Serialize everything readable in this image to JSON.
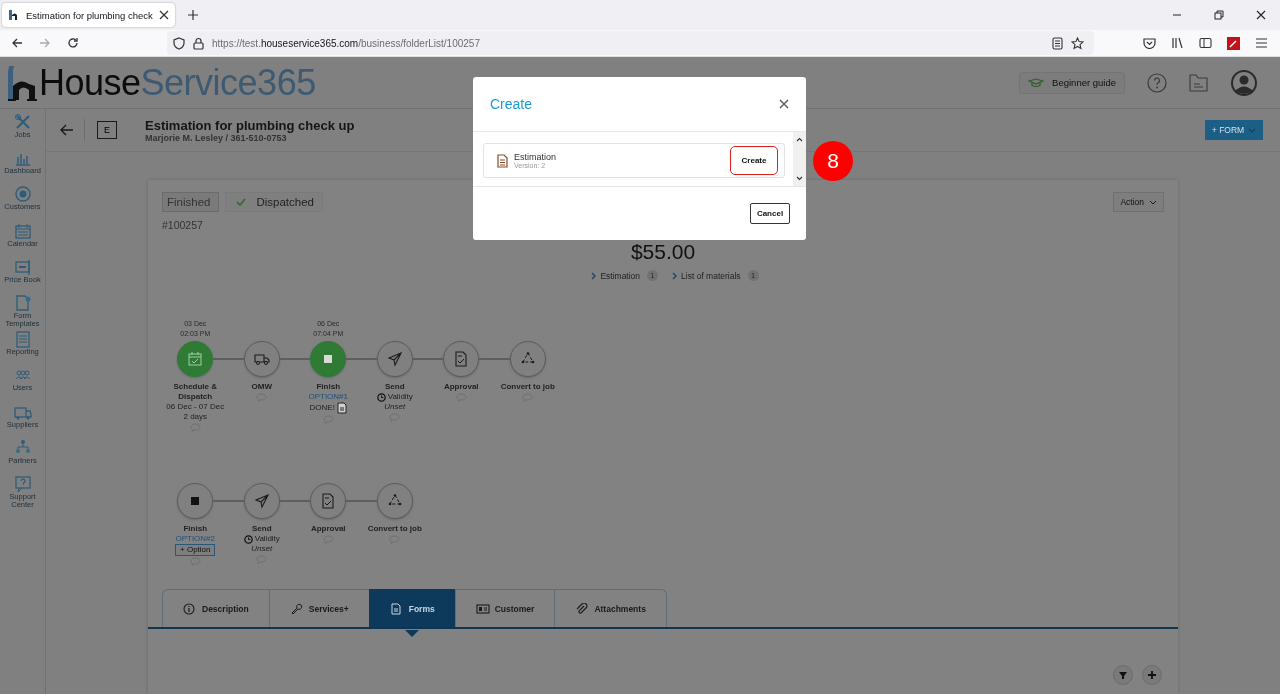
{
  "browser": {
    "tab_title": "Estimation for plumbing check",
    "url": {
      "scheme": "https://test.",
      "domain": "houseservice365.com",
      "path": "/business/folderList/100257"
    }
  },
  "header": {
    "logo": {
      "first": "House",
      "second": "Service365"
    },
    "guide_button": "Beginner guide"
  },
  "sidebar": {
    "items": [
      "Jobs",
      "Dashboard",
      "Customers",
      "Calendar",
      "Price Book",
      "Form Templates",
      "Reporting",
      "Users",
      "Suppliers",
      "Partners",
      "Support Center"
    ]
  },
  "job": {
    "badge": "E",
    "title": "Estimation for plumbing check up",
    "subtitle": "Marjorie M. Lesley / 361-510-0753",
    "form_button": "+ FORM"
  },
  "card": {
    "statuses": [
      {
        "label": "Finished",
        "selected": true,
        "checked": false
      },
      {
        "label": "Dispatched",
        "selected": false,
        "checked": true
      }
    ],
    "number": "#100257",
    "action_button": "Action",
    "total": "$55.00",
    "links": [
      {
        "label": "Estimation",
        "count": "1"
      },
      {
        "label": "List of materials",
        "count": "1"
      }
    ]
  },
  "workflows": [
    [
      {
        "kind": "schedule",
        "done": true,
        "date": "03 Dec",
        "time": "02:03 PM",
        "label": "Schedule & Dispatch",
        "lines": [
          {
            "kind": "text",
            "text": "06 Dec - 07 Dec"
          },
          {
            "kind": "text",
            "text": "2 days"
          }
        ]
      },
      {
        "kind": "omw",
        "done": false,
        "label": "OMW"
      },
      {
        "kind": "finish",
        "done": true,
        "date": "06 Dec",
        "time": "07:04 PM",
        "label": "Finish",
        "lines": [
          {
            "kind": "option",
            "text": "OPTION#1"
          },
          {
            "kind": "done",
            "text": "DONE!"
          }
        ]
      },
      {
        "kind": "send",
        "done": false,
        "label": "Send",
        "lines": [
          {
            "kind": "validity",
            "text": "Validity"
          },
          {
            "kind": "note",
            "text": "Unset"
          }
        ]
      },
      {
        "kind": "approval",
        "done": false,
        "label": "Approval"
      },
      {
        "kind": "convert",
        "done": false,
        "label": "Convert to job"
      }
    ],
    [
      {
        "kind": "finish",
        "done": false,
        "label": "Finish",
        "lines": [
          {
            "kind": "option",
            "text": "OPTION#2"
          },
          {
            "kind": "add_button",
            "text": "+ Option"
          }
        ]
      },
      {
        "kind": "send",
        "done": false,
        "label": "Send",
        "lines": [
          {
            "kind": "validity",
            "text": "Validity"
          },
          {
            "kind": "note",
            "text": "Unset"
          }
        ]
      },
      {
        "kind": "approval",
        "done": false,
        "label": "Approval"
      },
      {
        "kind": "convert",
        "done": false,
        "label": "Convert to job"
      }
    ]
  ],
  "tabs": [
    {
      "label": "Description",
      "selected": false
    },
    {
      "label": "Services+",
      "selected": false
    },
    {
      "label": "Forms",
      "selected": true
    },
    {
      "label": "Customer",
      "selected": false
    },
    {
      "label": "Attachments",
      "selected": false
    }
  ],
  "modal": {
    "title": "Create",
    "items": [
      {
        "name": "Estimation",
        "version": "Version: 2",
        "button": "Create"
      }
    ],
    "cancel": "Cancel"
  },
  "annotation": "8"
}
